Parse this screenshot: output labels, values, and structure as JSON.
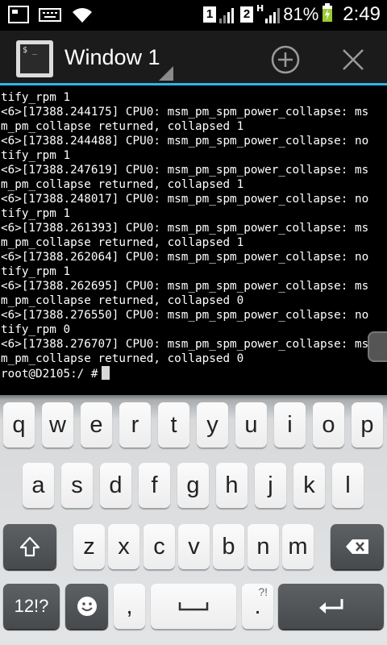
{
  "status_bar": {
    "sim1": "1",
    "sim2": "2",
    "network_type": "H",
    "battery_percent": "81%",
    "time": "2:49",
    "icons": [
      "screenshot-icon",
      "keyboard-icon",
      "wifi-icon",
      "signal-icon",
      "battery-charging-icon"
    ]
  },
  "action_bar": {
    "icon_text": "$ _",
    "title": "Window 1",
    "accent_color": "#33b5e5"
  },
  "terminal": {
    "lines": [
      "tify_rpm 1",
      "<6>[17388.244175] CPU0: msm_pm_spm_power_collapse: ms",
      "m_pm_collapse returned, collapsed 1",
      "<6>[17388.244488] CPU0: msm_pm_spm_power_collapse: no",
      "tify_rpm 1",
      "<6>[17388.247619] CPU0: msm_pm_spm_power_collapse: ms",
      "m_pm_collapse returned, collapsed 1",
      "<6>[17388.248017] CPU0: msm_pm_spm_power_collapse: no",
      "tify_rpm 1",
      "<6>[17388.261393] CPU0: msm_pm_spm_power_collapse: ms",
      "m_pm_collapse returned, collapsed 1",
      "<6>[17388.262064] CPU0: msm_pm_spm_power_collapse: no",
      "tify_rpm 1",
      "<6>[17388.262695] CPU0: msm_pm_spm_power_collapse: ms",
      "m_pm_collapse returned, collapsed 0",
      "<6>[17388.276550] CPU0: msm_pm_spm_power_collapse: no",
      "tify_rpm 0",
      "<6>[17388.276707] CPU0: msm_pm_spm_power_collapse: ms",
      "m_pm_collapse returned, collapsed 0"
    ],
    "prompt": "root@D2105:/ #"
  },
  "keyboard": {
    "row1": [
      "q",
      "w",
      "e",
      "r",
      "t",
      "y",
      "u",
      "i",
      "o",
      "p"
    ],
    "row2": [
      "a",
      "s",
      "d",
      "f",
      "g",
      "h",
      "j",
      "k",
      "l"
    ],
    "row3": [
      "z",
      "x",
      "c",
      "v",
      "b",
      "n",
      "m"
    ],
    "symbols_label": "12!?",
    "comma_label": ",",
    "period_label": ".",
    "period_alt": "?!"
  }
}
